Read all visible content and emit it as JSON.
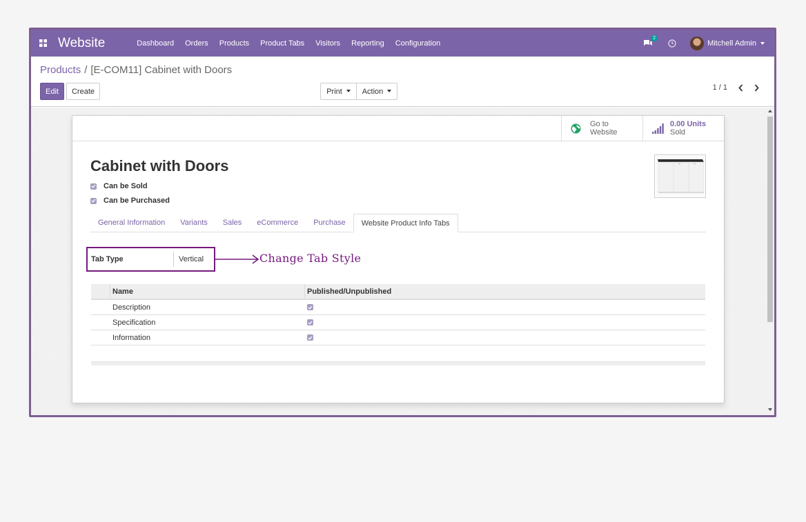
{
  "navbar": {
    "app_name": "Website",
    "menu": [
      "Dashboard",
      "Orders",
      "Products",
      "Product Tabs",
      "Visitors",
      "Reporting",
      "Configuration"
    ],
    "message_count": "2",
    "user_name": "Mitchell Admin",
    "bg_color": "#7c64a8"
  },
  "breadcrumb": {
    "parent": "Products",
    "separator": "/",
    "current": "[E-COM11] Cabinet with Doors"
  },
  "actions": {
    "edit": "Edit",
    "create": "Create",
    "print": "Print",
    "action": "Action"
  },
  "pager": {
    "value": "1 / 1"
  },
  "smart_buttons": {
    "website_line1": "Go to",
    "website_line2": "Website",
    "units_value": "0.00 Units",
    "units_label": "Sold"
  },
  "product": {
    "name": "Cabinet with Doors",
    "can_be_sold_label": "Can be Sold",
    "can_be_purchased_label": "Can be Purchased",
    "can_be_sold": true,
    "can_be_purchased": true
  },
  "tabs": [
    "General Information",
    "Variants",
    "Sales",
    "eCommerce",
    "Purchase",
    "Website Product Info Tabs"
  ],
  "active_tab": "Website Product Info Tabs",
  "tab_type": {
    "label": "Tab Type",
    "value": "Vertical"
  },
  "annotation": "Change Tab Style",
  "table": {
    "headers": [
      "Name",
      "Published/Unpublished"
    ],
    "rows": [
      {
        "name": "Description",
        "published": true
      },
      {
        "name": "Specification",
        "published": true
      },
      {
        "name": "Information",
        "published": true
      }
    ]
  }
}
